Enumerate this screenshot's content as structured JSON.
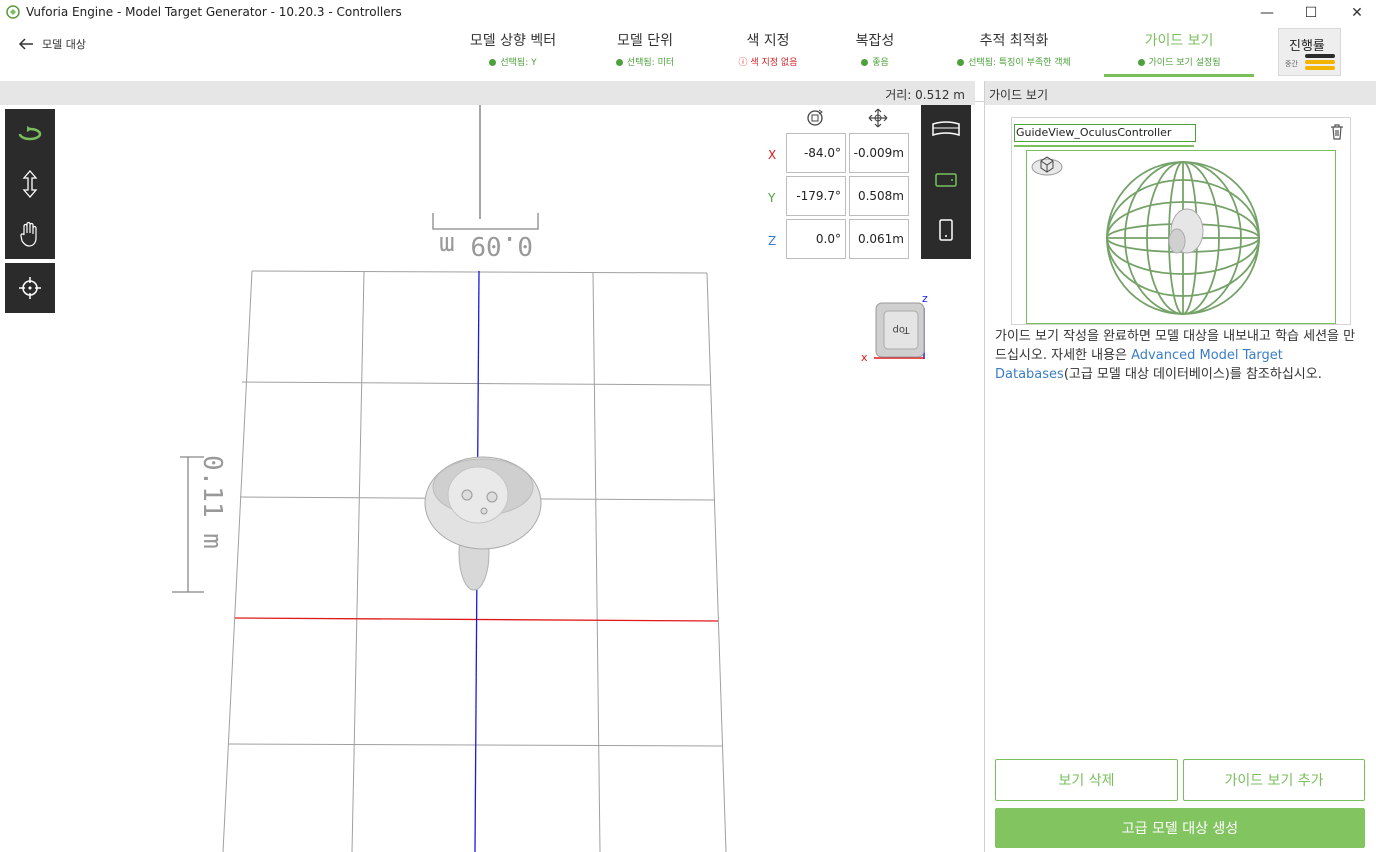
{
  "window": {
    "title": "Vuforia Engine - Model Target Generator - 10.20.3 - Controllers",
    "minimize": "—",
    "maximize": "☐",
    "close": "✕"
  },
  "nav": {
    "back_label": "모델 대상",
    "steps": [
      {
        "label": "모델 상향 벡터",
        "status": "선택됨: Y"
      },
      {
        "label": "모델 단위",
        "status": "선택됨: 미터"
      },
      {
        "label": "색 지정",
        "status": "색 지정 없음"
      },
      {
        "label": "복잡성",
        "status": "좋음"
      },
      {
        "label": "추적 최적화",
        "status": "선택됨: 특징이 부족한 객체"
      },
      {
        "label": "가이드 보기",
        "status": "가이드 보기 설정됨"
      }
    ],
    "progress": {
      "label": "진행률",
      "sub": "중간"
    },
    "colors": {
      "accent": "#7bbf5d",
      "ok": "#4ca13b",
      "warn": "#d32222"
    }
  },
  "viewport": {
    "distance": "거리: 0.512 m",
    "scale_top": "0.09 m",
    "scale_left": "0.11 m",
    "rotation": {
      "x": "-84.0°",
      "y": "-179.7°",
      "z": "0.0°"
    },
    "position": {
      "x": "-0.009m",
      "y": "0.508m",
      "z": "0.061m"
    },
    "axes": {
      "x": "X",
      "y": "Y",
      "z": "Z"
    },
    "cube": {
      "face": "Top",
      "x": "x",
      "z": "z"
    }
  },
  "guide_panel": {
    "header": "가이드 보기",
    "view_name": "GuideView_OculusController",
    "description_pre": "가이드 보기 작성을 완료하면 모델 대상을 내보내고 학습 세션을 만드십시오. 자세한 내용은 ",
    "description_link": "Advanced Model Target Databases",
    "description_post": "(고급 모델 대상 데이터베이스)를 참조하십시오.",
    "delete_view": "보기 삭제",
    "add_view": "가이드 보기 추가",
    "create_button": "고급 모델 대상 생성"
  }
}
